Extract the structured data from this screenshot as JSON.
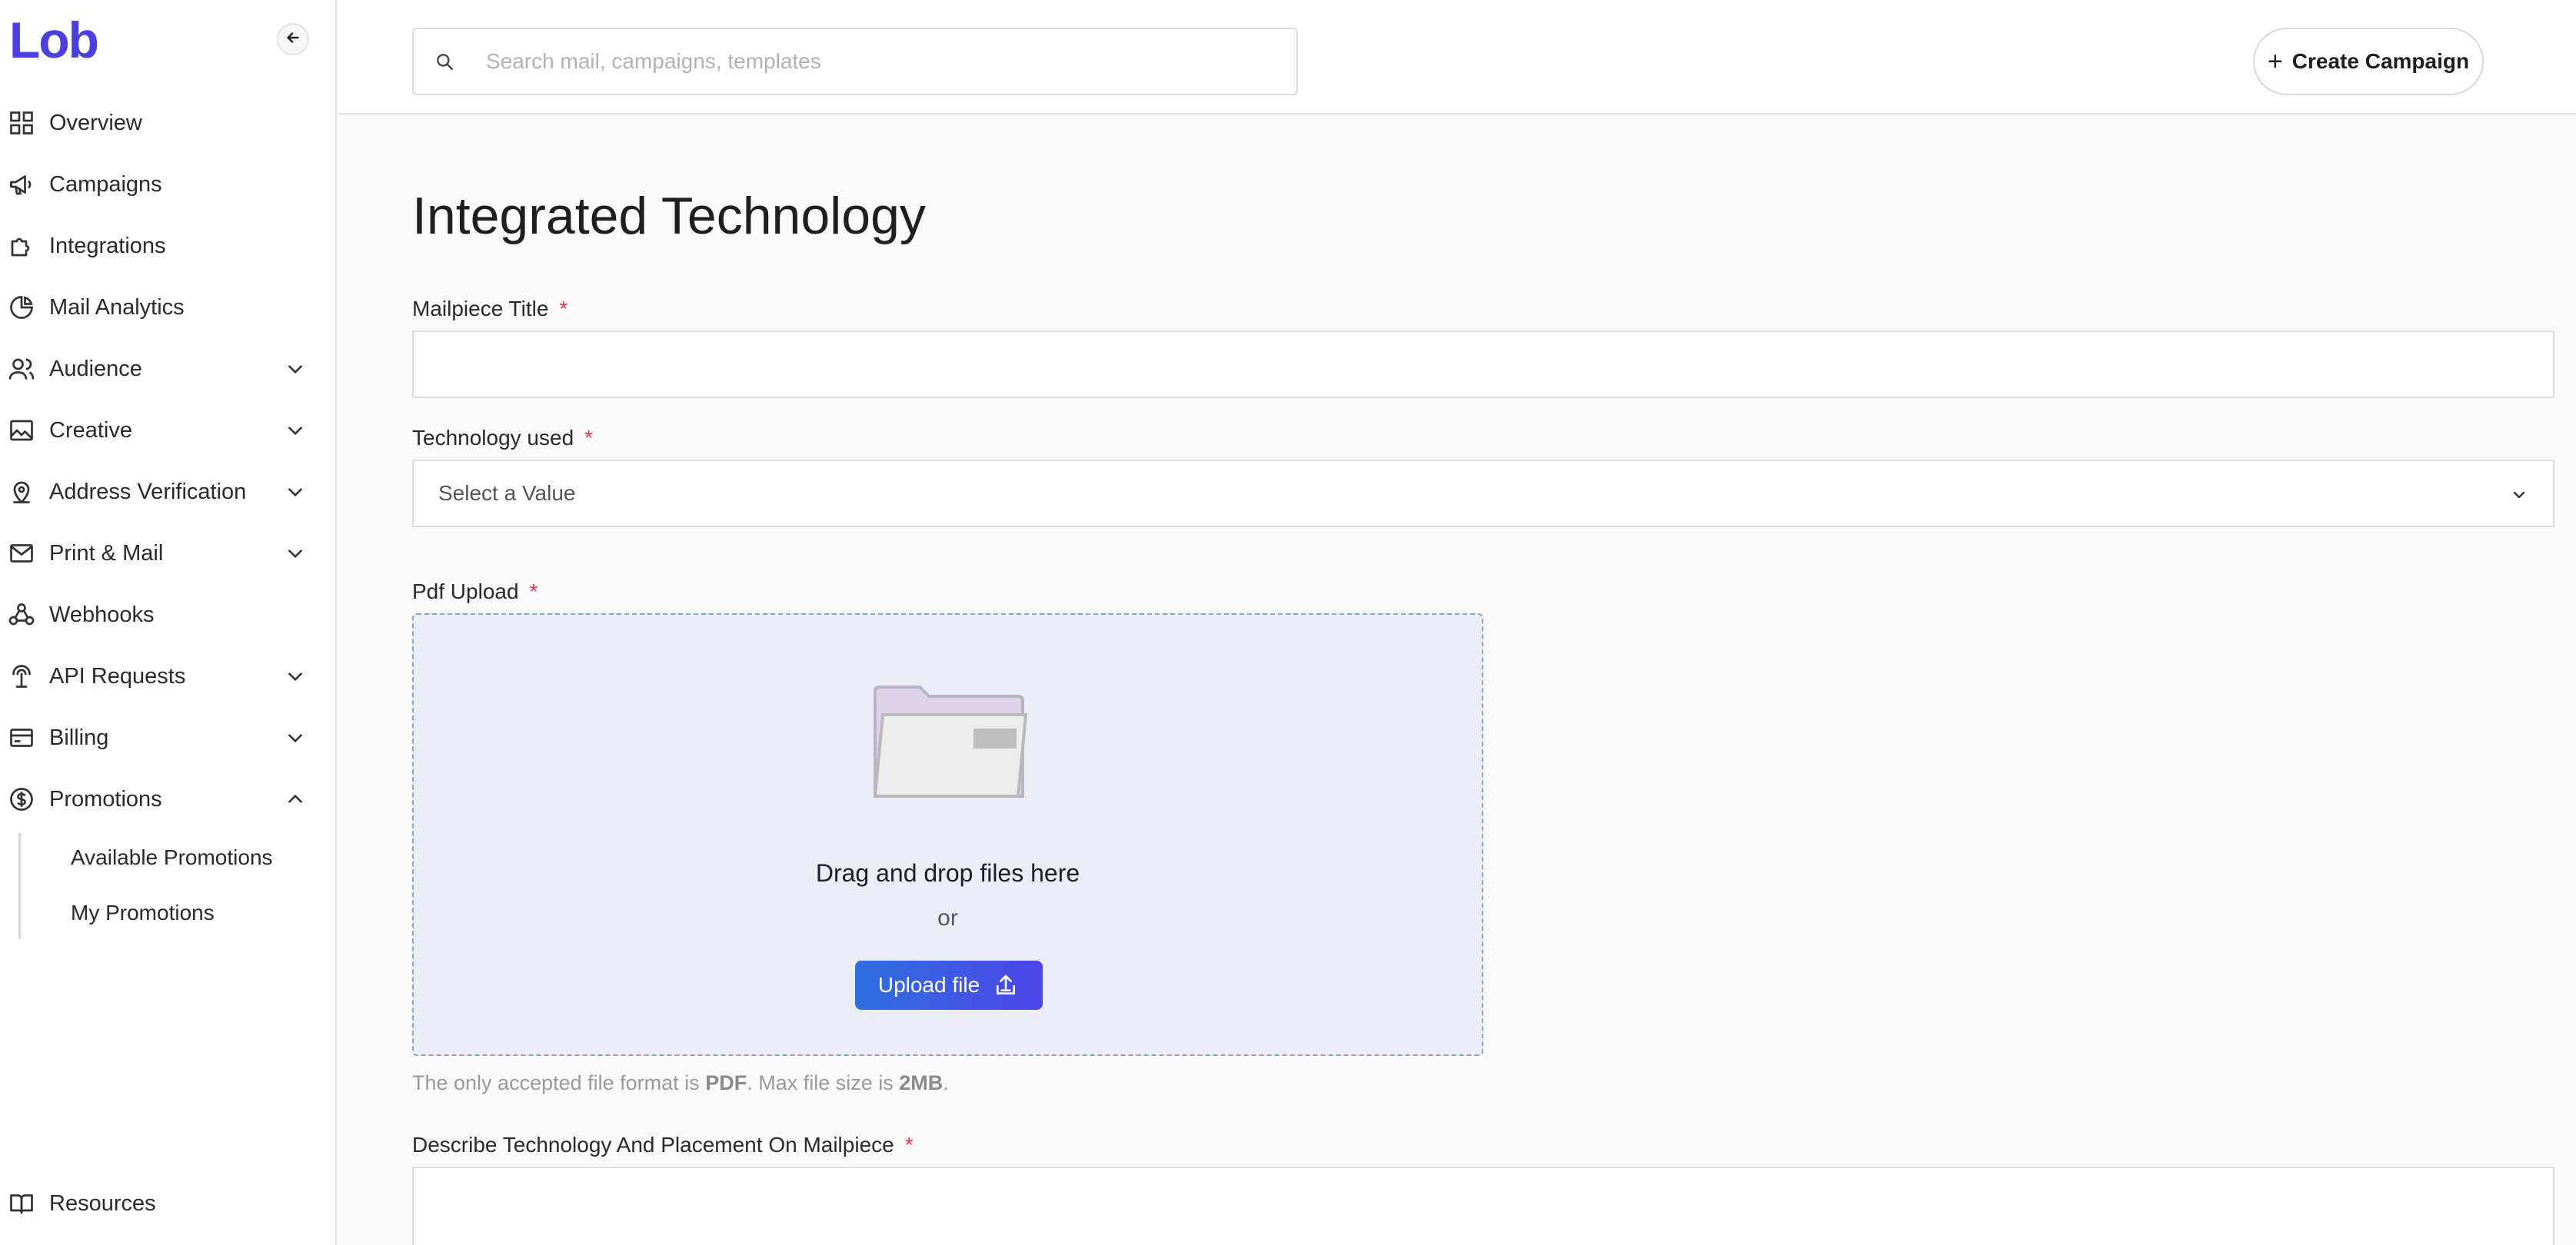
{
  "brand": {
    "logo_text": "Lob",
    "accent": "#4a3fe0"
  },
  "sidebar": {
    "collapse_icon": "arrow-left-icon",
    "items": [
      {
        "label": "Overview",
        "icon": "grid-icon",
        "expandable": false
      },
      {
        "label": "Campaigns",
        "icon": "megaphone-icon",
        "expandable": false
      },
      {
        "label": "Integrations",
        "icon": "puzzle-icon",
        "expandable": false
      },
      {
        "label": "Mail Analytics",
        "icon": "pie-chart-icon",
        "expandable": false
      },
      {
        "label": "Audience",
        "icon": "users-icon",
        "expandable": true
      },
      {
        "label": "Creative",
        "icon": "image-icon",
        "expandable": true
      },
      {
        "label": "Address Verification",
        "icon": "map-pin-icon",
        "expandable": true
      },
      {
        "label": "Print & Mail",
        "icon": "envelope-icon",
        "expandable": true
      },
      {
        "label": "Webhooks",
        "icon": "webhook-icon",
        "expandable": false
      },
      {
        "label": "API Requests",
        "icon": "antenna-icon",
        "expandable": true
      },
      {
        "label": "Billing",
        "icon": "credit-card-icon",
        "expandable": true
      },
      {
        "label": "Promotions",
        "icon": "dollar-circle-icon",
        "expandable": true,
        "expanded": true
      }
    ],
    "promotions_sub": [
      {
        "label": "Available Promotions"
      },
      {
        "label": "My Promotions"
      }
    ],
    "footer": {
      "label": "Resources",
      "icon": "book-icon"
    }
  },
  "header": {
    "search_placeholder": "Search mail, campaigns, templates",
    "create_label": "Create Campaign"
  },
  "form": {
    "title": "Integrated Technology",
    "mailpiece_title_label": "Mailpiece Title",
    "mailpiece_title_value": "",
    "technology_label": "Technology used",
    "technology_value": "Select a Value",
    "pdf_label": "Pdf Upload",
    "dropzone_text": "Drag and drop files here",
    "dropzone_or": "or",
    "upload_label": "Upload file",
    "hint_prefix": "The only accepted file format is ",
    "hint_format": "PDF",
    "hint_middle": ". Max file size is ",
    "hint_size": "2MB",
    "hint_suffix": ".",
    "describe_label": "Describe Technology And Placement On Mailpiece",
    "describe_value": "",
    "required_mark": "*"
  }
}
